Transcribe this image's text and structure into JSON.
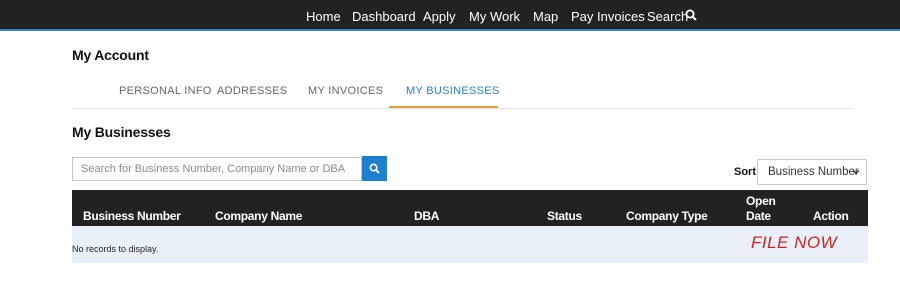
{
  "nav": {
    "items": [
      "Home",
      "Dashboard",
      "Apply",
      "My Work",
      "Map",
      "Pay Invoices",
      "Search"
    ]
  },
  "account": {
    "title": "My Account"
  },
  "tabs": [
    {
      "label": "PERSONAL INFO",
      "active": false
    },
    {
      "label": "ADDRESSES",
      "active": false
    },
    {
      "label": "MY INVOICES",
      "active": false
    },
    {
      "label": "MY BUSINESSES",
      "active": true
    }
  ],
  "businesses": {
    "title": "My Businesses",
    "search_placeholder": "Search for Business Number, Company Name or DBA",
    "sort_label": "Sort",
    "sort_value": "Business Number",
    "columns": [
      "Business Number",
      "Company Name",
      "DBA",
      "Status",
      "Company Type",
      "Open",
      "Date",
      "Action"
    ],
    "empty_text": "No records to display.",
    "file_now": "FILE NOW"
  },
  "colors": {
    "nav_bg": "#222222",
    "accent": "#1e7fcf",
    "tab_active": "#2a7fc1",
    "tab_underline": "#e8a33d",
    "file_now": "#d42020",
    "row_bg": "#e8f1fa"
  },
  "icons": [
    "search-icon",
    "chevron-down-icon"
  ]
}
